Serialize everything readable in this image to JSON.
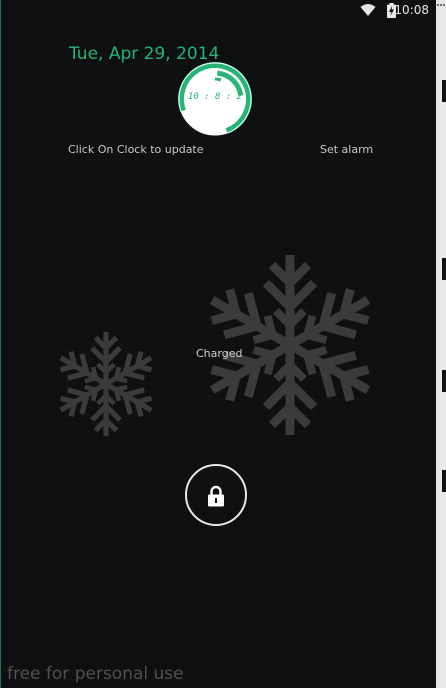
{
  "status_bar": {
    "time": "10:08",
    "icons": [
      "wifi-icon",
      "battery-charging-icon",
      "overflow-icon"
    ]
  },
  "lockscreen": {
    "date": "Tue, Apr 29, 2014",
    "clock": {
      "time_text": "10 : 8 : 2",
      "accent_color": "#27b577"
    },
    "hint_label": "Click On Clock to update",
    "alarm_label": "Set alarm",
    "battery_status": "Charged",
    "lock_button_icon": "lock-icon",
    "watermark": "free for personal use"
  },
  "colors": {
    "accent": "#27b577",
    "background": "#0d0f10",
    "snowflake": "#3a3b3d"
  }
}
